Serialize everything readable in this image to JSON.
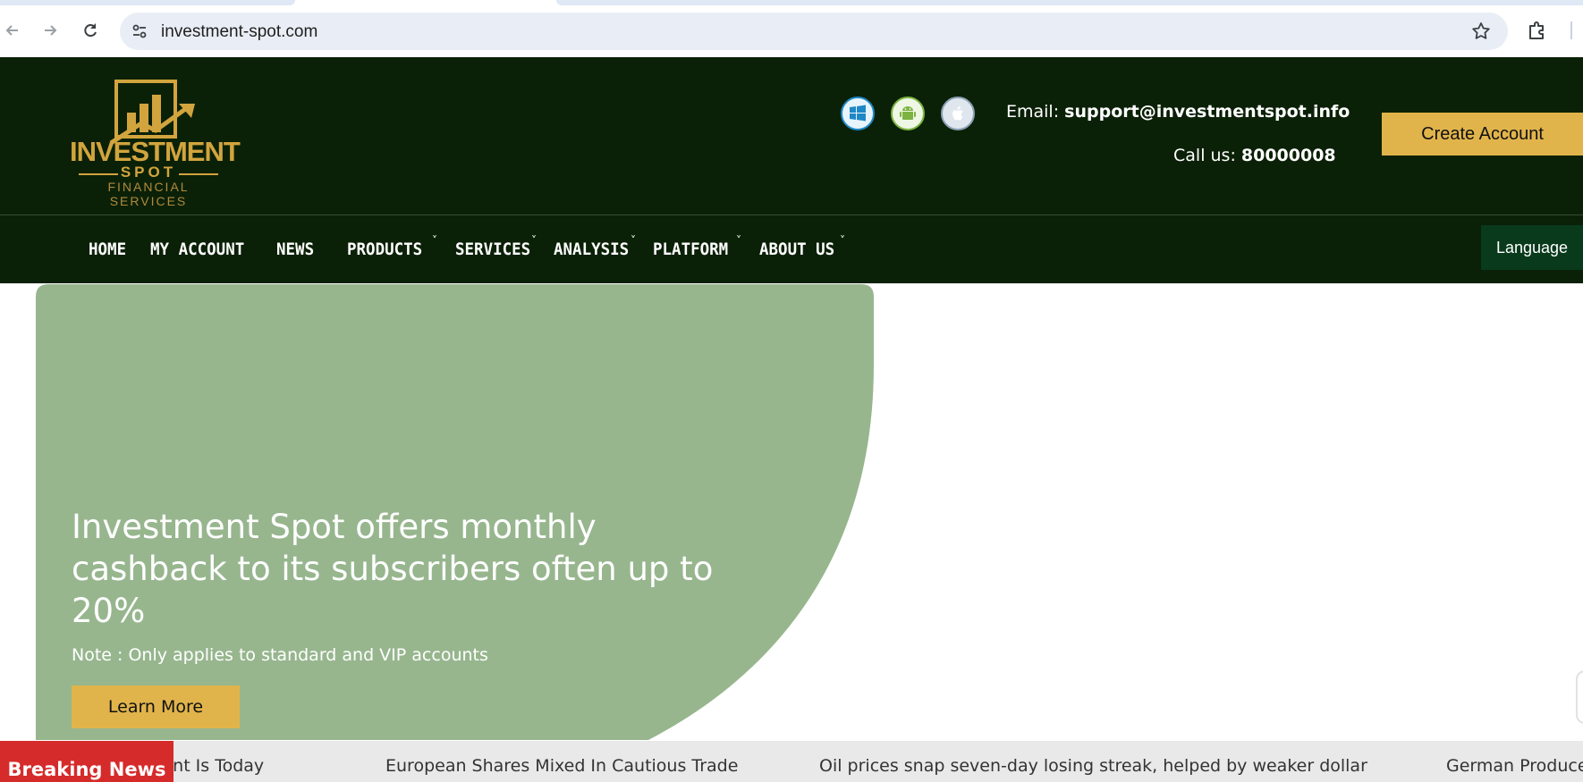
{
  "browser": {
    "url": "investment-spot.com"
  },
  "logo": {
    "main": "INVESTMENT",
    "spot": "SPOT",
    "sub": "FINANCIAL SERVICES"
  },
  "header": {
    "email_label": "Email: ",
    "email_value": "support@investmentspot.info",
    "call_label": "Call us: ",
    "call_value": "80000008",
    "create_account": "Create Account",
    "platforms": [
      "windows-icon",
      "android-icon",
      "apple-icon"
    ]
  },
  "nav": {
    "items": [
      {
        "label": "HOME"
      },
      {
        "label": "MY ACCOUNT"
      },
      {
        "label": "NEWS"
      },
      {
        "label": "PRODUCTS"
      },
      {
        "label": "SERVICES"
      },
      {
        "label": "ANALYSIS"
      },
      {
        "label": "PLATFORM"
      },
      {
        "label": "ABOUT US"
      }
    ],
    "language": "Language"
  },
  "hero": {
    "title": "Investment Spot offers monthly cashback to its subscribers often up to 20%",
    "note": "Note : Only applies to standard and VIP accounts",
    "button": "Learn More"
  },
  "ticker": {
    "label": "Breaking News",
    "items": [
      "Fed Rate Decision Event Is Today",
      "European Shares Mixed In Cautious Trade",
      "Oil prices snap seven-day losing streak, helped by weaker dollar",
      "German Producer Prices"
    ]
  },
  "colors": {
    "header_bg": "#0b2107",
    "accent_gold": "#e1b44b",
    "hero_green": "#97b68e",
    "breaking_red": "#d52b2b",
    "language_bg": "#093a1c"
  }
}
